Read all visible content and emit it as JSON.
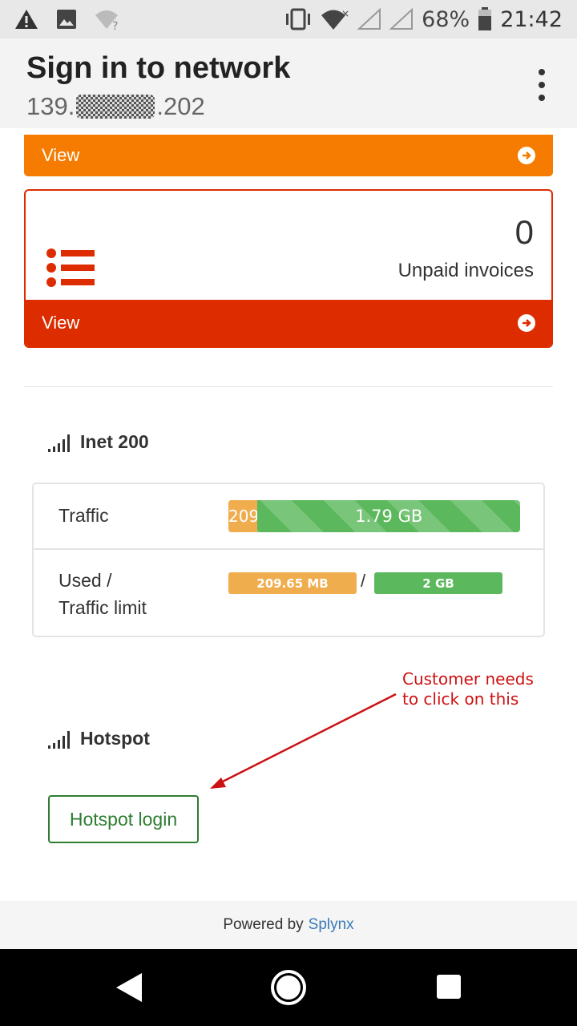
{
  "status_bar": {
    "battery_percent": "68%",
    "time": "21:42",
    "icons": [
      "warning-icon",
      "image-icon",
      "wifi-question-icon",
      "vibrate-icon",
      "wifi-icon",
      "signal-icon",
      "signal-icon",
      "battery-icon"
    ]
  },
  "app_bar": {
    "title": "Sign in to network",
    "ip_prefix": "139.",
    "ip_suffix": ".202"
  },
  "orange_card": {
    "view_label": "View",
    "color": "#f57c00"
  },
  "invoices_card": {
    "count": "0",
    "label": "Unpaid invoices",
    "view_label": "View",
    "color": "#dd2c00"
  },
  "inet_section": {
    "title": "Inet 200",
    "traffic_label": "Traffic",
    "progress_used_text": "209",
    "progress_total_text": "1.79 GB",
    "progress_used_fraction": 0.1,
    "used_label_line1": "Used /",
    "used_label_line2": "Traffic limit",
    "used_badge": "209.65 MB",
    "slash": "/",
    "limit_badge": "2 GB"
  },
  "annotation": {
    "line1": "Customer needs",
    "line2": "to click on this",
    "color": "#cc1111"
  },
  "hotspot_section": {
    "title": "Hotspot",
    "button_label": "Hotspot login"
  },
  "footer": {
    "powered_by": "Powered by",
    "brand": "Splynx"
  }
}
